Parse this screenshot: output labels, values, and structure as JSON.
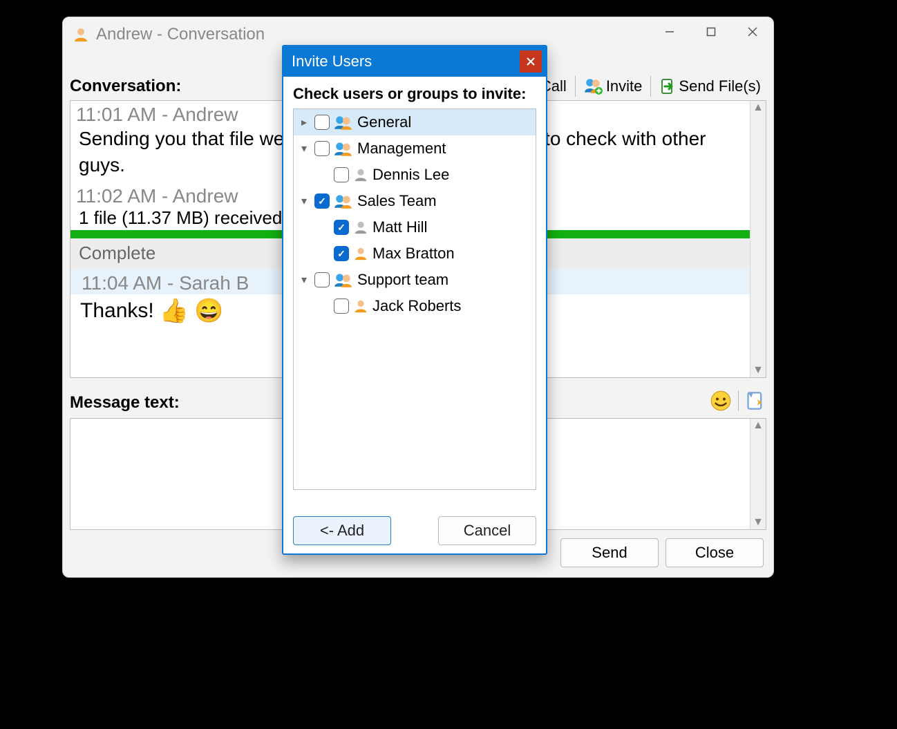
{
  "window": {
    "title": "Andrew - Conversation",
    "controls": {
      "minimize": "–",
      "maximize": "□",
      "close": "×"
    }
  },
  "toolbar": {
    "label": "Conversation:",
    "call": "Call",
    "invite": "Invite",
    "sendfiles": "Send File(s)"
  },
  "conversation": {
    "msg1": {
      "meta": "11:01 AM - Andrew",
      "body": "Sending you that file we talked about. You might need to check with other guys."
    },
    "msg2": {
      "meta": "11:02 AM - Andrew",
      "file_line": "1 file (11.37 MB) received",
      "status": "Complete"
    },
    "msg3": {
      "meta": "11:04 AM - Sarah B",
      "body": "Thanks!",
      "emoji1": "👍",
      "emoji2": "😄"
    }
  },
  "compose": {
    "label": "Message text:",
    "value": ""
  },
  "buttons": {
    "send": "Send",
    "close": "Close"
  },
  "dialog": {
    "title": "Invite Users",
    "instruction": "Check users or groups to invite:",
    "tree": [
      {
        "type": "group",
        "label": "General",
        "checked": false,
        "expanded": false,
        "selected": true,
        "children": []
      },
      {
        "type": "group",
        "label": "Management",
        "checked": false,
        "expanded": true,
        "selected": false,
        "children": [
          {
            "type": "user",
            "label": "Dennis Lee",
            "checked": false,
            "online": false
          }
        ]
      },
      {
        "type": "group",
        "label": "Sales Team",
        "checked": true,
        "expanded": true,
        "selected": false,
        "children": [
          {
            "type": "user",
            "label": "Matt Hill",
            "checked": true,
            "online": false
          },
          {
            "type": "user",
            "label": "Max Bratton",
            "checked": true,
            "online": true
          }
        ]
      },
      {
        "type": "group",
        "label": "Support team",
        "checked": false,
        "expanded": true,
        "selected": false,
        "children": [
          {
            "type": "user",
            "label": "Jack Roberts",
            "checked": false,
            "online": true
          }
        ]
      }
    ],
    "add": "<- Add",
    "cancel": "Cancel"
  }
}
